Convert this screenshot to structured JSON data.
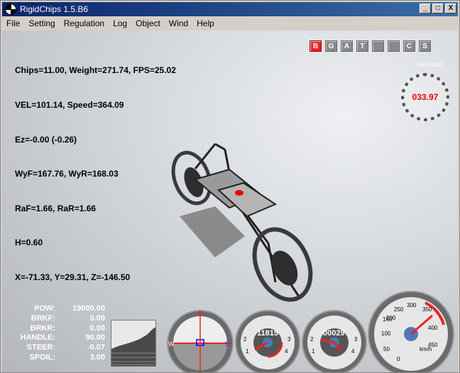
{
  "window": {
    "title": "RigidChips 1.5.B6"
  },
  "window_buttons": {
    "minimize": "_",
    "maximize": "□",
    "close": "X"
  },
  "menu": [
    "File",
    "Setting",
    "Regulation",
    "Log",
    "Object",
    "Wind",
    "Help"
  ],
  "stats": [
    "Chips=11.00, Weight=271.74, FPS=25.02",
    "VEL=101.14, Speed=364.09",
    "Ez=-0.00 (-0.26)",
    "WyF=167.76, WyR=168.03",
    "RaF=1.66, RaR=1.66",
    "H=0.60",
    "X=-71.33, Y=29.31, Z=-146.50"
  ],
  "keys": [
    "B",
    "G",
    "A",
    "T",
    "",
    "",
    "C",
    "S"
  ],
  "keys_active": "B",
  "camera_label": "onscar",
  "lap_time": "033.97",
  "params": [
    {
      "label": "POW:",
      "value": "19000.00"
    },
    {
      "label": "BRKF:",
      "value": "0.00"
    },
    {
      "label": "BRKR:",
      "value": "0.00"
    },
    {
      "label": "HANDLE:",
      "value": "90.00"
    },
    {
      "label": "STEER:",
      "value": "-0.07"
    },
    {
      "label": "SPOIL:",
      "value": "3.00"
    }
  ],
  "gauges": {
    "rpm_readout": "11815",
    "odo_readout": "00029",
    "speed_unit": "km/h",
    "speed_ticks": [
      "0",
      "50",
      "100",
      "150",
      "200",
      "250",
      "300",
      "350",
      "400",
      "450"
    ],
    "rpm_ticks": [
      "1",
      "2",
      "3",
      "4"
    ],
    "odo_ticks": [
      "1",
      "2",
      "3",
      "4"
    ],
    "compass_n": "N",
    "compass_w": "W",
    "compass_e": "E"
  },
  "colors": {
    "accent_red": "#e22222",
    "title_bar": "#0a246a"
  }
}
